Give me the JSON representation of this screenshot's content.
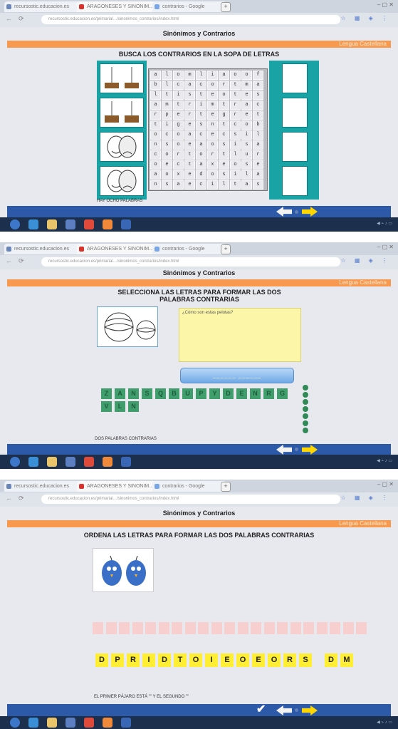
{
  "colors": {
    "orange": "#f79a4f",
    "blue": "#2d5aa8",
    "teal": "#1aa3a4",
    "green": "#3f9e6b",
    "yellow": "#ffee33",
    "pink": "#f7cfcf",
    "accent_arrow": "#ffd600"
  },
  "app_title": "Sinónimos y Contrarios",
  "subject": "Lengua Castellana",
  "panels": [
    {
      "instruction": "BUSCA LOS CONTRARIOS EN LA SOPA DE LETRAS",
      "footer": "HAY OCHO PALABRAS"
    },
    {
      "instruction": "SELECCIONA LAS LETRAS PARA FORMAR LAS DOS PALABRAS CONTRARIAS",
      "question": "¿Cómo son estas pelotas?",
      "answer_placeholder": "______  ______",
      "footer": "DOS PALABRAS CONTRARIAS"
    },
    {
      "instruction": "ORDENA LAS LETRAS PARA FORMAR LAS DOS PALABRAS CONTRARIAS",
      "footer": "EL PRIMER PÁJARO ESTÁ \"\" Y EL SEGUNDO \"\""
    }
  ],
  "wordsearch": [
    [
      "a",
      "l",
      "o",
      "m",
      "l",
      "i",
      "a",
      "o",
      "o",
      "f"
    ],
    [
      "b",
      "l",
      "c",
      "a",
      "c",
      "o",
      "r",
      "t",
      "m",
      "a"
    ],
    [
      "l",
      "t",
      "i",
      "s",
      "t",
      "e",
      "o",
      "t",
      "e",
      "s"
    ],
    [
      "a",
      "m",
      "t",
      "r",
      "i",
      "m",
      "t",
      "r",
      "a",
      "c"
    ],
    [
      "r",
      "p",
      "e",
      "r",
      "t",
      "e",
      "g",
      "r",
      "e",
      "t"
    ],
    [
      "t",
      "i",
      "g",
      "e",
      "s",
      "n",
      "t",
      "c",
      "o",
      "b"
    ],
    [
      "o",
      "c",
      "o",
      "a",
      "c",
      "e",
      "c",
      "s",
      "i",
      "l"
    ],
    [
      "n",
      "s",
      "o",
      "e",
      "a",
      "o",
      "s",
      "i",
      "s",
      "a"
    ],
    [
      "c",
      "o",
      "r",
      "t",
      "o",
      "r",
      "t",
      "l",
      "u",
      "r"
    ],
    [
      "o",
      "e",
      "c",
      "t",
      "a",
      "x",
      "e",
      "o",
      "s",
      "e"
    ],
    [
      "a",
      "o",
      "x",
      "e",
      "d",
      "o",
      "s",
      "i",
      "l",
      "a"
    ],
    [
      "n",
      "s",
      "a",
      "e",
      "c",
      "i",
      "l",
      "t",
      "a",
      "s"
    ]
  ],
  "green_tiles_row1": [
    "Z",
    "A",
    "N",
    "S",
    "Q",
    "B",
    "U",
    "P",
    "Y",
    "D",
    "E",
    "N",
    "R",
    "G"
  ],
  "green_tiles_row2": [
    "V",
    "L",
    "N"
  ],
  "yellow_tiles": [
    "D",
    "P",
    "R",
    "I",
    "D",
    "T",
    "O",
    "I",
    "E",
    "O",
    "E",
    "O",
    "R",
    "S",
    "D",
    "M"
  ],
  "browser": {
    "tabs": [
      "recursostic.educacion.es",
      "ARAGONESES Y SINONIM...",
      "contrarios - Google"
    ],
    "address": "recursostic.educacion.es/primaria/.../sinonimos_contrarios/index.html"
  },
  "icons": [
    "refresh-icon",
    "star-icon",
    "extension-icon",
    "menu-icon"
  ]
}
